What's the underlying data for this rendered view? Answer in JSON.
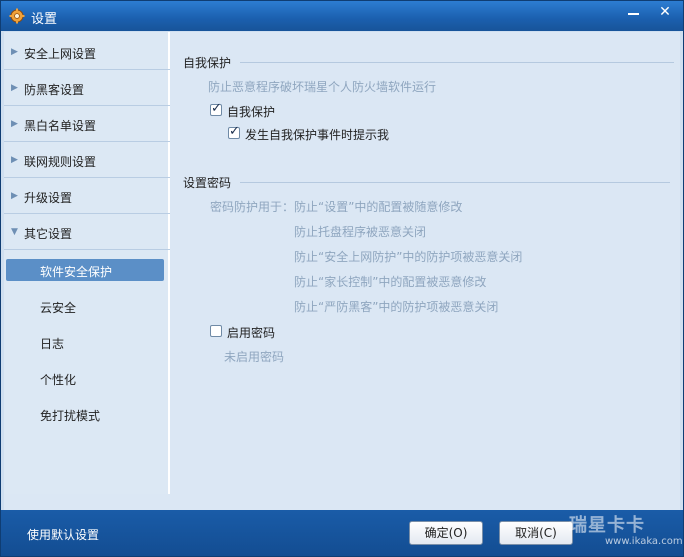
{
  "window": {
    "title": "设置",
    "min_glyph": "",
    "close_glyph": "✕"
  },
  "sidebar": {
    "sections": [
      {
        "label": "安全上网设置",
        "arrow": "▶"
      },
      {
        "label": "防黑客设置",
        "arrow": "▶"
      },
      {
        "label": "黑白名单设置",
        "arrow": "▶"
      },
      {
        "label": "联网规则设置",
        "arrow": "▶"
      },
      {
        "label": "升级设置",
        "arrow": "▶"
      },
      {
        "label": "其它设置",
        "arrow": "▼"
      }
    ],
    "subitems": [
      {
        "label": "软件安全保护",
        "active": true
      },
      {
        "label": "云安全"
      },
      {
        "label": "日志"
      },
      {
        "label": "个性化"
      },
      {
        "label": "免打扰模式"
      }
    ]
  },
  "self_protect": {
    "title": "自我保护",
    "description": "防止恶意程序破坏瑞星个人防火墙软件运行",
    "checkbox1": {
      "label": "自我保护",
      "checked": true
    },
    "checkbox2": {
      "label": "发生自我保护事件时提示我",
      "checked": true
    }
  },
  "password": {
    "title": "设置密码",
    "intro": "密码防护用于：",
    "items": [
      "防止“设置”中的配置被随意修改",
      "防止托盘程序被恶意关闭",
      "防止“安全上网防护”中的防护项被恶意关闭",
      "防止“家长控制”中的配置被恶意修改",
      "防止“严防黑客”中的防护项被恶意关闭"
    ],
    "enable_checkbox": {
      "label": "启用密码",
      "checked": false
    },
    "status": "未启用密码"
  },
  "bottom": {
    "default_link": "使用默认设置",
    "ok_label": "确定(O)",
    "cancel_label": "取消(C)"
  },
  "watermark": {
    "text": "瑞星卡卡",
    "url": "www.ikaka.com"
  },
  "colors": {
    "titlebar": "#1b5fae",
    "content_bg": "#dbe7f4",
    "active_item": "#5b8fc7",
    "muted_text": "#8fa6bf"
  }
}
